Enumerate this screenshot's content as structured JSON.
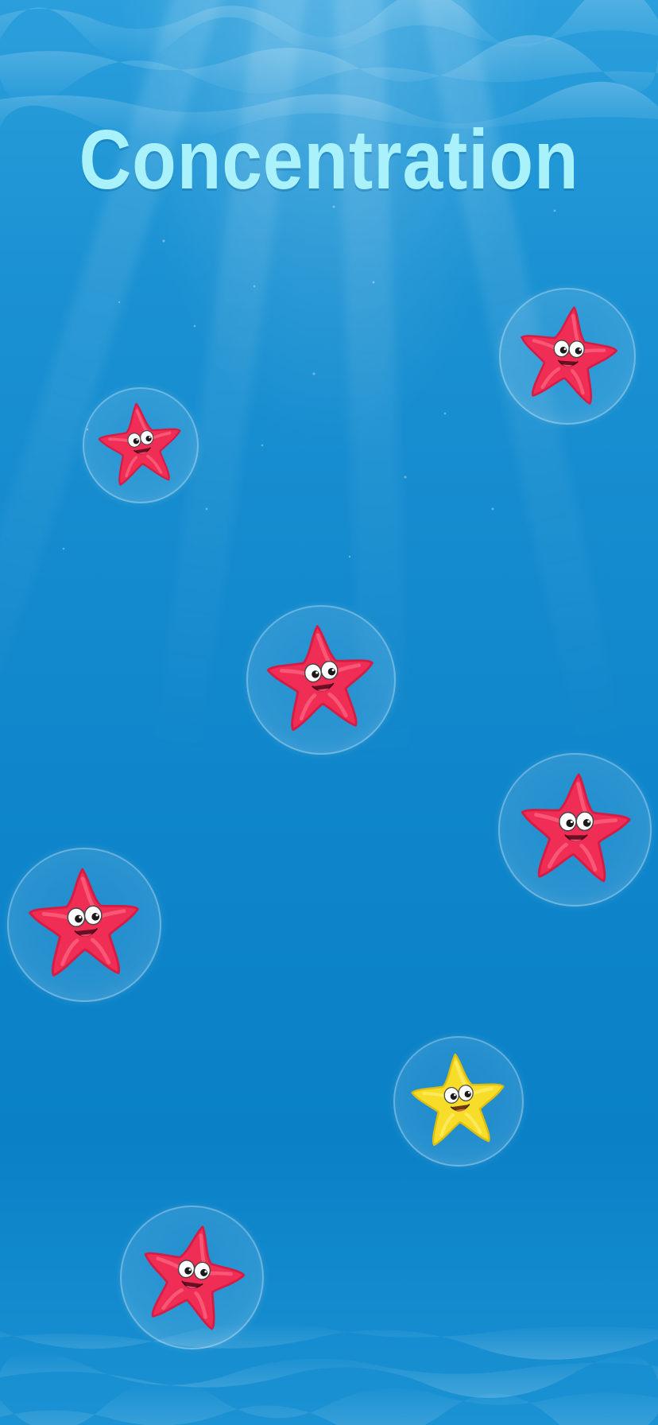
{
  "game": {
    "title": "Concentration"
  },
  "colors": {
    "water_top": "#2b9fdc",
    "water_bottom": "#0a81c7",
    "title": "#a9f1fb",
    "starfish_red": "#ef2d55",
    "starfish_yellow": "#f7dd2a"
  },
  "starfish": [
    {
      "id": 1,
      "color": "red"
    },
    {
      "id": 2,
      "color": "red"
    },
    {
      "id": 3,
      "color": "red"
    },
    {
      "id": 4,
      "color": "red"
    },
    {
      "id": 5,
      "color": "red"
    },
    {
      "id": 6,
      "color": "yellow"
    },
    {
      "id": 7,
      "color": "red"
    }
  ]
}
